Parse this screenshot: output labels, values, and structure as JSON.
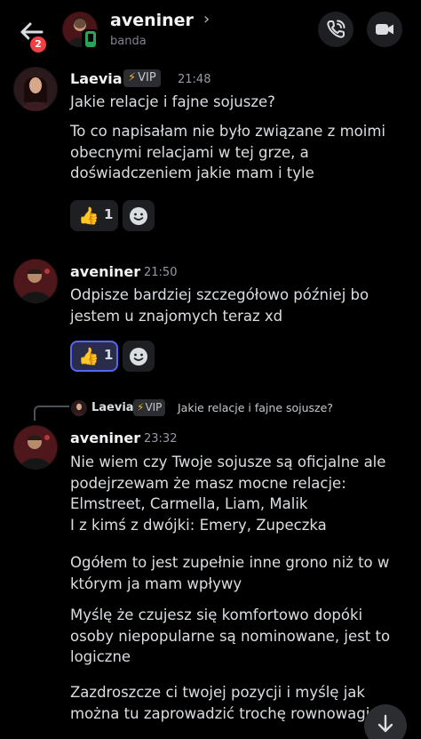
{
  "header": {
    "title": "aveniner",
    "subtitle": "banda",
    "unread_count": "2",
    "icons": [
      "back-arrow-icon",
      "chevron-right-icon",
      "phone-call-icon",
      "video-camera-icon",
      "mobile-status-icon"
    ]
  },
  "messages": [
    {
      "author": "Laevia",
      "badge": "VIP",
      "time": "21:48",
      "text": "Jakie relacje i fajne sojusze?\nTo co napisałam nie było związane z moimi obecnymi relacjami w tej grze, a doświadczeniem jakie mam i tyle",
      "lines": [
        "Jakie relacje i fajne sojusze?",
        "To co napisałam nie było związane z moimi obecnymi relacjami w tej grze, a doświadczeniem jakie mam i tyle"
      ],
      "reaction": {
        "emoji": "thumbs-up-icon",
        "count": "1",
        "selected": false
      }
    },
    {
      "author": "aveniner",
      "time": "21:50",
      "lines": [
        "Odpisze bardziej szczegółowo później bo jestem u znajomych teraz xd"
      ],
      "reaction": {
        "emoji": "thumbs-up-icon",
        "count": "1",
        "selected": true
      }
    },
    {
      "reply": {
        "author": "Laevia",
        "badge": "VIP",
        "text": "Jakie relacje i fajne sojusze?"
      },
      "author": "aveniner",
      "time": "23:32",
      "lines": [
        "Nie wiem czy Twoje sojusze są oficjalne ale podejrzewam że masz mocne relacje:\nElmstreet, Carmella, Liam, Malik\nI z kimś z dwójki: Emery, Zupeczka",
        "Ogółem to jest zupełnie inne grono niż to w którym ja mam wpływy",
        "Myślę że czujesz się komfortowo dopóki osoby niepopularne są nominowane, jest to logiczne",
        "Zazdroszcze ci twojej pozycji i myślę jak można tu zaprowadzić trochę rownowagi"
      ]
    }
  ],
  "colors": {
    "accent": "#5865f2",
    "badge_red": "#f23f43",
    "online_green": "#23a55a",
    "bolt": "#f0b232"
  }
}
